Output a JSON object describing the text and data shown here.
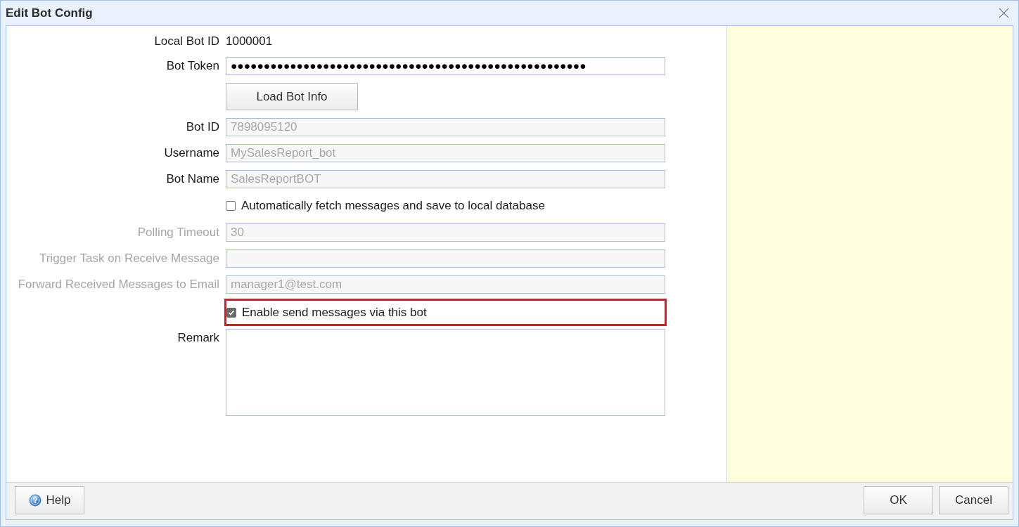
{
  "window": {
    "title": "Edit Bot Config"
  },
  "form": {
    "rows": [
      {
        "kind": "value",
        "label": "Local Bot ID",
        "value": "1000001"
      },
      {
        "kind": "password",
        "label": "Bot Token",
        "value": "●●●●●●●●●●●●●●●●●●●●●●●●●●●●●●●●●●●●●●●●●●●●●●●●●●●●●●"
      },
      {
        "kind": "button",
        "label": "Load Bot Info"
      },
      {
        "kind": "text",
        "label": "Bot ID",
        "value": "7898095120",
        "disabled": false,
        "readonly": true
      },
      {
        "kind": "text",
        "label": "Username",
        "value": "MySalesReport_bot",
        "disabled": false,
        "readonly": true
      },
      {
        "kind": "text",
        "label": "Bot Name",
        "value": "SalesReportBOT",
        "disabled": false,
        "readonly": true
      },
      {
        "kind": "checkbox",
        "label": "Automatically fetch messages and save to local database",
        "checked": false,
        "highlighted": false
      },
      {
        "kind": "text",
        "label": "Polling Timeout",
        "value": "30",
        "disabled": true,
        "readonly": false
      },
      {
        "kind": "text",
        "label": "Trigger Task on Receive Message",
        "disabled": true,
        "readonly": false
      },
      {
        "kind": "text",
        "label": "Forward Received Messages to Email",
        "value": "manager1@test.com",
        "disabled": true,
        "readonly": false
      },
      {
        "kind": "checkbox",
        "label": "Enable send messages via this bot",
        "checked": true,
        "highlighted": true
      },
      {
        "kind": "textarea",
        "label": "Remark"
      }
    ]
  },
  "footer": {
    "left_buttons": [
      {
        "label": "Help"
      }
    ],
    "right_buttons": [
      {
        "label": "OK"
      },
      {
        "label": "Cancel"
      }
    ]
  }
}
